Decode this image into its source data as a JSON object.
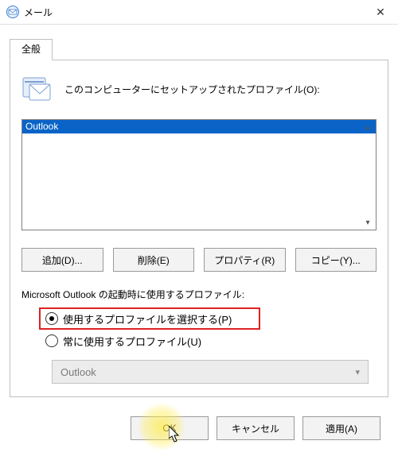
{
  "window": {
    "title": "メール",
    "close_symbol": "✕"
  },
  "tab": {
    "label": "全般"
  },
  "header": {
    "label": "このコンピューターにセットアップされたプロファイル(O):"
  },
  "profiles": {
    "items": [
      "Outlook"
    ],
    "selected_index": 0
  },
  "profile_buttons": {
    "add": "追加(D)...",
    "remove": "削除(E)",
    "props": "プロパティ(R)",
    "copy": "コピー(Y)..."
  },
  "startup": {
    "section_label": "Microsoft Outlook の起動時に使用するプロファイル:",
    "prompt_label": "使用するプロファイルを選択する(P)",
    "always_label": "常に使用するプロファイル(U)",
    "selected": "prompt",
    "default_profile": "Outlook"
  },
  "dialog_buttons": {
    "ok": "OK",
    "cancel": "キャンセル",
    "apply": "適用(A)"
  }
}
